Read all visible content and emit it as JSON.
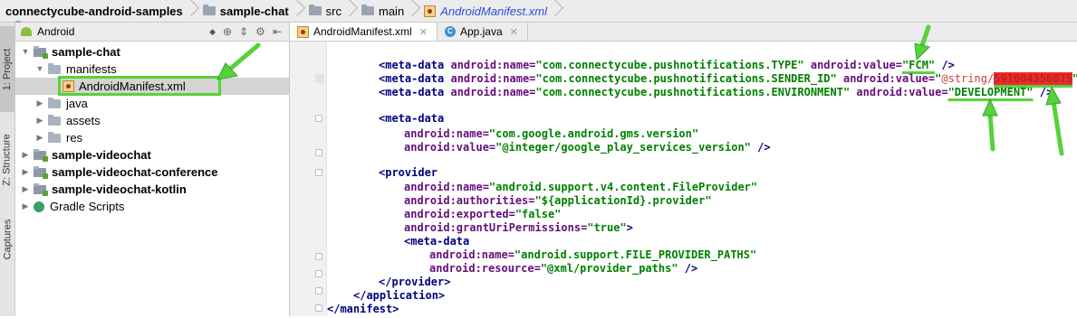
{
  "breadcrumb": {
    "items": [
      "connectycube-android-samples",
      "sample-chat",
      "src",
      "main",
      "AndroidManifest.xml"
    ]
  },
  "tool_strip": {
    "project_tab": "1: Project",
    "structure_tab": "Z: Structure",
    "captures_tab": "Captures"
  },
  "project_panel": {
    "view_selector": "Android",
    "tree": [
      {
        "label": "sample-chat",
        "bold": true
      },
      {
        "label": "manifests"
      },
      {
        "label": "AndroidManifest.xml",
        "selected": true
      },
      {
        "label": "java"
      },
      {
        "label": "assets"
      },
      {
        "label": "res"
      },
      {
        "label": "sample-videochat",
        "bold": true
      },
      {
        "label": "sample-videochat-conference",
        "bold": true
      },
      {
        "label": "sample-videochat-kotlin",
        "bold": true
      },
      {
        "label": "Gradle Scripts"
      }
    ]
  },
  "editor_tabs": [
    {
      "label": "AndroidManifest.xml",
      "active": true
    },
    {
      "label": "App.java",
      "active": false
    }
  ],
  "code": {
    "l1": {
      "tag": "<meta-data",
      "a1": "android:name=",
      "v1": "\"com.connectycube.pushnotifications.TYPE\"",
      "a2": "android:value=",
      "v2": "\"FCM\"",
      "end": " />"
    },
    "l2": {
      "tag": "<meta-data",
      "a1": "android:name=",
      "v1": "\"com.connectycube.pushnotifications.SENDER_ID\"",
      "a2": "android:value=",
      "v2a": "\"",
      "v2ref": "@string/",
      "v2red": "591004356075",
      "v2b": "\"",
      "end": " />"
    },
    "l3": {
      "tag": "<meta-data",
      "a1": "android:name=",
      "v1": "\"com.connectycube.pushnotifications.ENVIRONMENT\"",
      "a2": "android:value=",
      "v2": "\"DEVELOPMENT\"",
      "end": " />"
    },
    "l4": {
      "tag": "<meta-data"
    },
    "l5": {
      "a": "android:name=",
      "v": "\"com.google.android.gms.version\""
    },
    "l6": {
      "a": "android:value=",
      "v": "\"@integer/google_play_services_version\"",
      "end": " />"
    },
    "l7": {
      "tag": "<provider"
    },
    "l8": {
      "a": "android:name=",
      "v": "\"android.support.v4.content.FileProvider\""
    },
    "l9": {
      "a": "android:authorities=",
      "v": "\"${applicationId}.provider\""
    },
    "l10": {
      "a": "android:exported=",
      "v": "\"false\""
    },
    "l11": {
      "a": "android:grantUriPermissions=",
      "v": "\"true\"",
      "end": ">"
    },
    "l12": {
      "tag": "<meta-data"
    },
    "l13": {
      "a": "android:name=",
      "v": "\"android.support.FILE_PROVIDER_PATHS\""
    },
    "l14": {
      "a": "android:resource=",
      "v": "\"@xml/provider_paths\"",
      "end": " />"
    },
    "l15": {
      "tag": "</provider>"
    },
    "l16": {
      "tag": "</application>"
    },
    "l17": {
      "tag": "</manifest>"
    }
  },
  "colors": {
    "tag": "#000080",
    "attribute": "#660e7a",
    "value": "#008000",
    "annotation": "#56d33a",
    "redaction": "#e82d2d"
  }
}
